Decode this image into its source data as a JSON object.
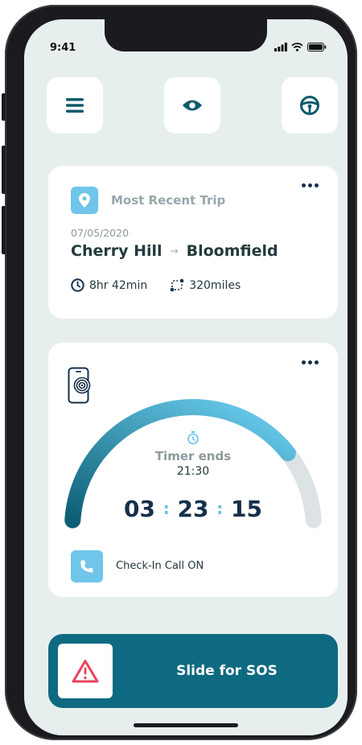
{
  "status_bar": {
    "time": "9:41",
    "icons": [
      "cellular-signal-icon",
      "wifi-icon",
      "battery-icon"
    ]
  },
  "top_bar": {
    "menu_icon": "hamburger-menu-icon",
    "eye_icon": "eye-icon",
    "wheel_icon": "steering-wheel-icon"
  },
  "recent_trip": {
    "title": "Most Recent Trip",
    "date": "07/05/2020",
    "from": "Cherry Hill",
    "arrow": "→",
    "to": "Bloomfield",
    "duration": "8hr 42min",
    "distance": "320miles",
    "icons": [
      "location-pin-icon",
      "clock-icon",
      "route-icon",
      "more-icon"
    ]
  },
  "timer": {
    "label": "Timer ends",
    "end_time": "21:30",
    "hours": "03",
    "minutes": "23",
    "seconds": "15",
    "separator": ":",
    "progress": 0.8,
    "call_label": "Check-In Call ON",
    "icons": [
      "phone-vibrate-icon",
      "stopwatch-icon",
      "phone-icon",
      "more-icon"
    ]
  },
  "sos": {
    "label": "Slide for SOS",
    "icon": "warning-triangle-icon"
  },
  "colors": {
    "background": "#e7efee",
    "card": "#ffffff",
    "accent_light": "#6fc5ea",
    "accent_dark": "#0e6a80",
    "text_dark": "#233a3d",
    "text_muted": "#9aa6ab",
    "track": "#dde2e5",
    "danger": "#e8455a"
  }
}
